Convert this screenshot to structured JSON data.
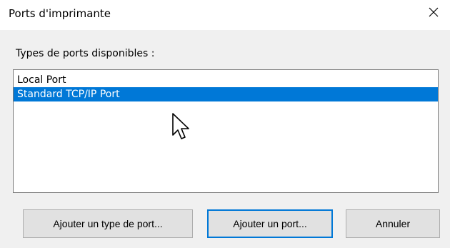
{
  "window": {
    "title": "Ports d'imprimante",
    "close_icon": "close-icon"
  },
  "list": {
    "label": "Types de ports disponibles :",
    "items": [
      {
        "label": "Local Port",
        "selected": false
      },
      {
        "label": "Standard TCP/IP Port",
        "selected": true
      }
    ],
    "selection_color": "#0078d7"
  },
  "buttons": {
    "add_port_type": "Ajouter un type de port...",
    "add_port": "Ajouter un port...",
    "cancel": "Annuler"
  },
  "cursor_icon": "mouse-pointer-icon"
}
